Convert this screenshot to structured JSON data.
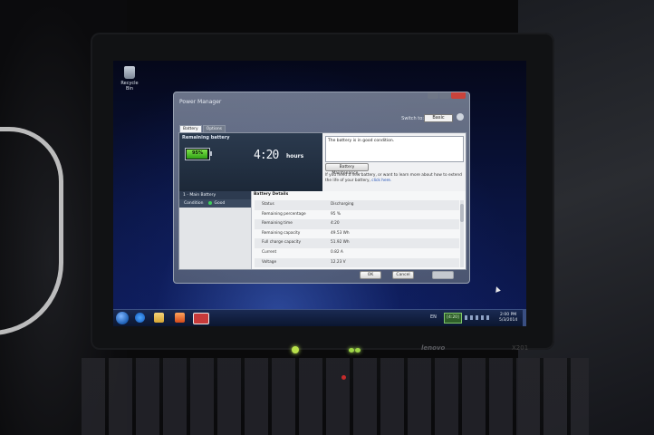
{
  "desktop": {
    "recycle_bin_label": "Recycle Bin"
  },
  "window": {
    "title": "Power Manager",
    "switch_to_label": "Switch to:",
    "switch_to_value": "Basic",
    "tabs": [
      {
        "label": "Battery",
        "active": true
      },
      {
        "label": "Options",
        "active": false
      }
    ],
    "remaining_battery_label": "Remaining battery",
    "battery_percent": "95%",
    "battery_level": 0.95,
    "remaining_time": "4:20",
    "remaining_time_unit": "hours",
    "message": "The battery is in good condition.",
    "maintenance_button": "Battery Maintenance...",
    "help_text": "If you need a new battery, or want to learn more about how to extend the life of your battery, ",
    "help_link": "click here.",
    "sidebar": {
      "header": "1 - Main Battery",
      "condition_label": "Condition",
      "condition_value": "Good"
    },
    "details": {
      "header": "Battery Details",
      "rows": [
        {
          "key": "Status",
          "value": "Discharging"
        },
        {
          "key": "Remaining percentage",
          "value": "95 %"
        },
        {
          "key": "Remaining time",
          "value": "4:20"
        },
        {
          "key": "Remaining capacity",
          "value": "49.53 Wh"
        },
        {
          "key": "Full charge capacity",
          "value": "51.92 Wh"
        },
        {
          "key": "Current",
          "value": "0.82 A"
        },
        {
          "key": "Voltage",
          "value": "12.23 V"
        }
      ]
    },
    "ok_label": "OK",
    "cancel_label": "Cancel"
  },
  "taskbar": {
    "language": "EN",
    "tray_battery": "[4:20]",
    "clock_time": "2:00 PM",
    "clock_date": "5/3/2014"
  },
  "laptop": {
    "brand": "lenovo",
    "model": "X201"
  }
}
